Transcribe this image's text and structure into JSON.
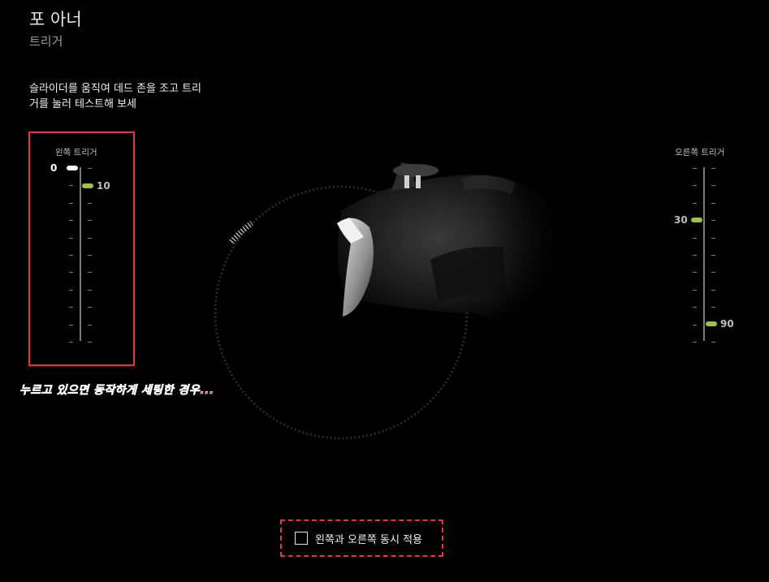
{
  "header": {
    "title": "포 아너",
    "subtitle": "트리거"
  },
  "instruction": "슬라이더를 움직여 데드 존을 조고 트리거를 눌러 테스트해 보세",
  "left_trigger": {
    "label": "왼쪽 트리거",
    "low_value": "0",
    "high_value": "10",
    "low_color": "#ffffff",
    "high_color": "#9bc53d"
  },
  "right_trigger": {
    "label": "오른쪽 트리거",
    "low_value": "30",
    "high_value": "90",
    "handle_color": "#9bc53d"
  },
  "annotation": "누르고 있으면 동작하게 세팅한 경우...",
  "apply_both": {
    "label": "왼쪽과 오른쪽 동시 적용",
    "checked": false
  },
  "colors": {
    "accent": "#9bc53d",
    "annotation_red": "#e8314a",
    "background": "#000000"
  }
}
